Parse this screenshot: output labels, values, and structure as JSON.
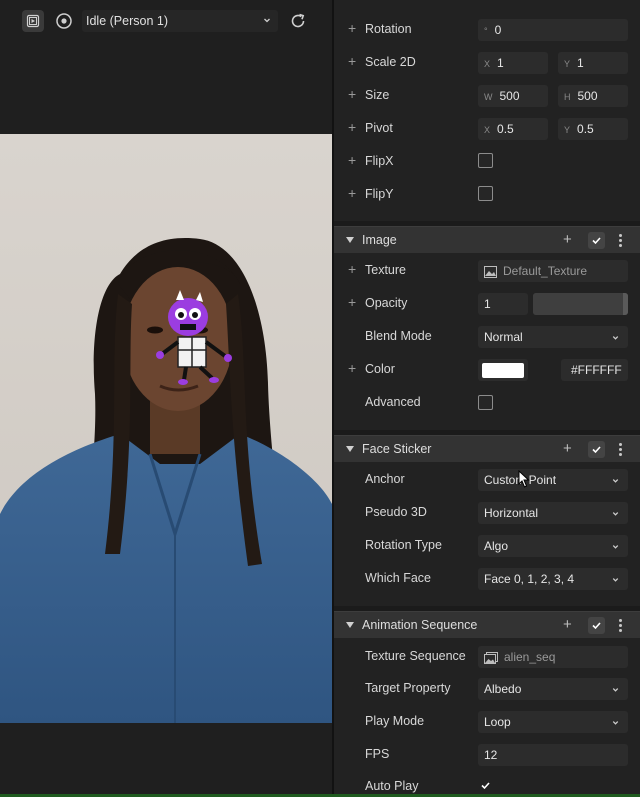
{
  "toolbar": {
    "selected_state": "Idle (Person 1)"
  },
  "transform": {
    "rotation": {
      "label": "Rotation",
      "prefix": "°",
      "value": "0"
    },
    "scale": {
      "label": "Scale 2D",
      "x_prefix": "X",
      "x": "1",
      "y_prefix": "Y",
      "y": "1"
    },
    "size": {
      "label": "Size",
      "w_prefix": "W",
      "w": "500",
      "h_prefix": "H",
      "h": "500"
    },
    "pivot": {
      "label": "Pivot",
      "x_prefix": "X",
      "x": "0.5",
      "y_prefix": "Y",
      "y": "0.5"
    },
    "flipx": {
      "label": "FlipX"
    },
    "flipy": {
      "label": "FlipY"
    }
  },
  "image": {
    "title": "Image",
    "texture": {
      "label": "Texture",
      "value": "Default_Texture"
    },
    "opacity": {
      "label": "Opacity",
      "value": "1",
      "level": 1.0
    },
    "blend_mode": {
      "label": "Blend Mode",
      "value": "Normal"
    },
    "color": {
      "label": "Color",
      "hex": "#FFFFFF",
      "swatch_color": "#ffffff"
    },
    "advanced": {
      "label": "Advanced"
    }
  },
  "face_sticker": {
    "title": "Face Sticker",
    "anchor": {
      "label": "Anchor",
      "value": "Custom Point"
    },
    "pseudo3d": {
      "label": "Pseudo 3D",
      "value": "Horizontal"
    },
    "rotation_type": {
      "label": "Rotation Type",
      "value": "Algo"
    },
    "which_face": {
      "label": "Which Face",
      "value": "Face 0, 1, 2, 3, 4"
    }
  },
  "animation_sequence": {
    "title": "Animation Sequence",
    "texture_sequence": {
      "label": "Texture Sequence",
      "value": "alien_seq"
    },
    "target_property": {
      "label": "Target Property",
      "value": "Albedo"
    },
    "play_mode": {
      "label": "Play Mode",
      "value": "Loop"
    },
    "fps": {
      "label": "FPS",
      "value": "12"
    },
    "auto_play": {
      "label": "Auto Play",
      "checked": true
    }
  },
  "icons": {
    "plus": "+"
  },
  "colors": {
    "panel_bg": "#222222",
    "section_bg": "#333333",
    "field_bg": "#2c2c2c",
    "accent_sticker": "#9b3de0"
  }
}
